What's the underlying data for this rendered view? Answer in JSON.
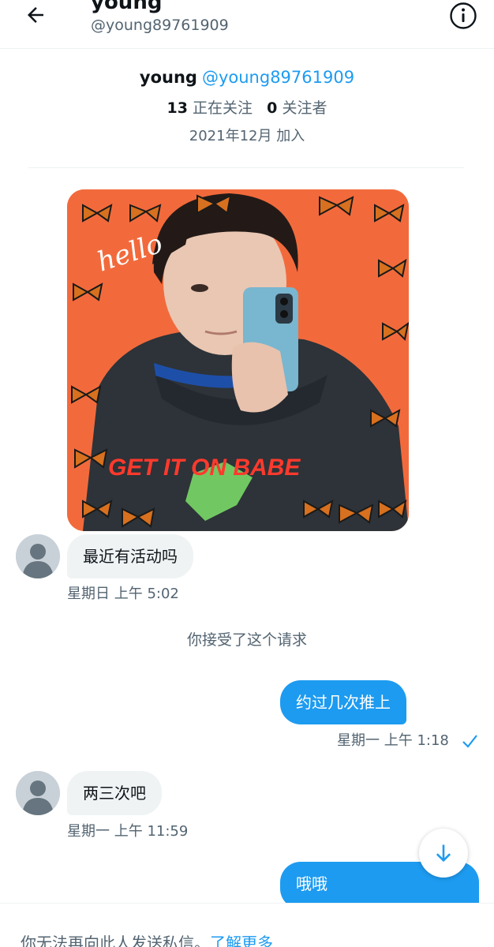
{
  "header": {
    "name": "young",
    "handle": "@young89761909",
    "back_icon": "arrow-left-icon",
    "info_icon": "info-icon"
  },
  "profile": {
    "name": "young",
    "handle": "@young89761909",
    "following_count": "13",
    "following_label": "正在关注",
    "followers_count": "0",
    "followers_label": "关注者",
    "joined": "2021年12月 加入"
  },
  "image": {
    "text_overlay": "GET IT ON BABE",
    "script_text": "hello"
  },
  "messages": [
    {
      "direction": "in",
      "text": "最近有活动吗",
      "time": "星期日 上午 5:02"
    },
    {
      "direction": "system",
      "text": "你接受了这个请求"
    },
    {
      "direction": "out",
      "text": "约过几次推上",
      "time": "星期一 上午 1:18",
      "status_icon": "check-icon"
    },
    {
      "direction": "in",
      "text": "两三次吧",
      "time": "星期一 上午 11:59"
    },
    {
      "direction": "out",
      "text": "哦哦"
    }
  ],
  "footer": {
    "notice": "你无法再向此人发送私信。",
    "link": "了解更多"
  },
  "colors": {
    "accent": "#1d9bf0",
    "bubble_in": "#eff3f4",
    "muted_text": "#536471",
    "photo_background": "#f26a3c"
  }
}
